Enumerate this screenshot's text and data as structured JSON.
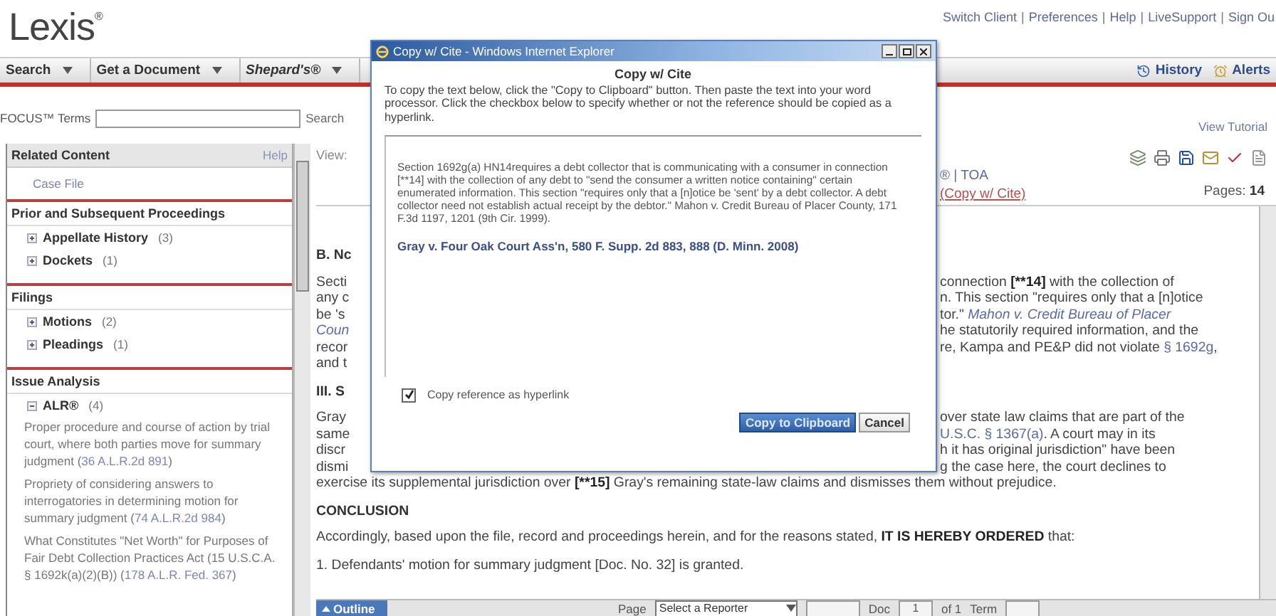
{
  "header": {
    "logo": "Lexis$^{®}$",
    "separator": "|",
    "links": [
      "Switch Client",
      "Preferences",
      "Help",
      "LiveSupport",
      "Sign Ou"
    ]
  },
  "nav": {
    "menus": [
      {
        "label": "Search",
        "italic": false
      },
      {
        "label": "Get a Document",
        "italic": false
      },
      {
        "label": "Shepard's®",
        "italic": true
      }
    ],
    "right": [
      {
        "label": "History",
        "kind": "history"
      },
      {
        "label": "Alerts",
        "kind": "clock"
      }
    ]
  },
  "focus": {
    "label": "FOCUS™ Terms",
    "button": "Search",
    "tutorial": "View Tutorial"
  },
  "sidebar": {
    "title": "Related Content",
    "help": "Help",
    "case_file": "Case File",
    "sections": [
      {
        "title": "Prior and Subsequent Proceedings",
        "items": [
          {
            "label": "Appellate History",
            "count": "(3)",
            "expanded": false
          },
          {
            "label": "Dockets",
            "count": "(1)",
            "expanded": false
          }
        ]
      },
      {
        "title": "Filings",
        "items": [
          {
            "label": "Motions",
            "count": "(2)",
            "expanded": false
          },
          {
            "label": "Pleadings",
            "count": "(1)",
            "expanded": false
          }
        ]
      },
      {
        "title": "Issue Analysis",
        "items": [
          {
            "label": "ALR®",
            "count": "(4)",
            "expanded": true,
            "children": [
              {
                "text": "Proper procedure and course of action by trial court, where both parties move for summary judgment (",
                "link": "36 A.L.R.2d 891",
                "after": ")"
              },
              {
                "text": "Propriety of considering answers to interrogatories in determining motion for summary judgment (",
                "link": "74 A.L.R.2d 984",
                "after": ")"
              },
              {
                "text": "What Constitutes \"Net Worth\" for Purposes of Fair Debt Collection Practices Act (15 U.S.C.A. § 1692k(a)(2)(B)) (",
                "link": "178 A.L.R. Fed. 367",
                "after": ")"
              }
            ]
          }
        ]
      }
    ]
  },
  "main": {
    "view_label": "View:",
    "toa": "® | TOA",
    "copy_cite": "(Copy w/ Cite)",
    "pages_label": "Pages:",
    "pages": "14",
    "tools": [
      {
        "kind": "stack"
      },
      {
        "kind": "print"
      },
      {
        "kind": "save"
      },
      {
        "kind": "mail"
      },
      {
        "kind": "check"
      },
      {
        "kind": "document"
      }
    ]
  },
  "body": [
    {
      "kind": "heading",
      "text": "B. Nc"
    },
    {
      "kind": "paragraph",
      "lines": [
        {
          "left": [
            {
              "text": "Secti"
            }
          ],
          "right": [
            {
              "text": "connection "
            },
            {
              "text": "[**14]",
              "kind": "bold"
            },
            {
              "text": " with the collection of"
            }
          ]
        },
        {
          "left": [
            {
              "text": "any c"
            }
          ],
          "right": [
            {
              "text": "n. This section \"requires only that a [n]otice"
            }
          ]
        },
        {
          "left": [
            {
              "text": "be 's"
            }
          ],
          "right": [
            {
              "text": "tor.\" "
            },
            {
              "text": "Mahon v. Credit Bureau of Placer",
              "kind": "italic_link"
            }
          ]
        },
        {
          "left": [
            {
              "text": "Coun",
              "kind": "italic_link"
            }
          ],
          "right": [
            {
              "text": "he statutorily required information, and the"
            }
          ]
        },
        {
          "left": [
            {
              "text": "recor"
            }
          ],
          "right": [
            {
              "text": "re, Kampa and PE&P did not violate "
            },
            {
              "text": "§ 1692g",
              "kind": "link"
            },
            {
              "text": ","
            }
          ]
        },
        {
          "left": [
            {
              "text": "and t"
            }
          ]
        }
      ]
    },
    {
      "kind": "heading",
      "text": "III. S"
    },
    {
      "kind": "paragraph",
      "lines": [
        {
          "left": [
            {
              "text": "Gray"
            }
          ],
          "right": [
            {
              "text": "over state law claims that are part of the"
            }
          ]
        },
        {
          "left": [
            {
              "text": "same"
            }
          ],
          "right": [
            {
              "text": "U.S.C. § 1367(a)",
              "kind": "link"
            },
            {
              "text": ". A court may in its"
            }
          ]
        },
        {
          "left": [
            {
              "text": "discr"
            }
          ],
          "right": [
            {
              "text": "h it has original jurisdiction\" have been"
            }
          ]
        },
        {
          "left": [
            {
              "text": "dismi"
            }
          ],
          "right": [
            {
              "text": "g the case here, the court declines to"
            }
          ]
        },
        {
          "full": [
            {
              "text": "exercise its supplemental jurisdiction over "
            },
            {
              "text": "[**15]",
              "kind": "bold"
            },
            {
              "text": " Gray's remaining state-law claims and dismisses them without prejudice."
            }
          ]
        }
      ]
    },
    {
      "kind": "heading",
      "text": "CONCLUSION"
    },
    {
      "kind": "paragraph",
      "lines": [
        {
          "full": [
            {
              "text": "Accordingly, based upon the file, record and proceedings herein, and for the reasons stated, "
            },
            {
              "text": "IT IS HEREBY ORDERED",
              "kind": "bold"
            },
            {
              "text": " that:"
            }
          ]
        }
      ]
    },
    {
      "kind": "paragraph",
      "lines": [
        {
          "full": [
            {
              "text": "1. Defendants' motion for summary judgment [Doc. No. 32] is granted."
            }
          ]
        }
      ]
    }
  ],
  "bottom_bar": {
    "outline": "Outline",
    "page_label": "Page",
    "reporter": "Select a Reporter",
    "doc_label": "Doc",
    "doc_value": "1",
    "doc_of": "of 1",
    "term_label": "Term"
  },
  "dialog": {
    "title": "Copy w/ Cite - Windows Internet Explorer",
    "heading": "Copy w/ Cite",
    "instructions": "To copy the text below, click the \"Copy to Clipboard\" button. Then paste the text into your word processor. Click the checkbox below to specify whether or not the reference should be copied as a hyperlink.",
    "excerpt": "Section 1692g(a) HN14requires a debt collector that is communicating with a consumer in connection [**14] with the collection of any debt to \"send the consumer a written notice containing\" certain enumerated information. This section \"requires only that a [n]otice be 'sent' by a debt collector. A debt collector need not establish actual receipt by the debtor.\" Mahon v. Credit Bureau of Placer County, 171 F.3d 1197, 1201 (9th Cir. 1999).",
    "citation": "Gray v. Four Oak Court Ass'n, 580 F. Supp. 2d 883, 888 (D. Minn. 2008)",
    "hyperlink": {
      "label": "Copy reference as hyperlink",
      "checked": true
    },
    "buttons": [
      {
        "label": "Copy to Clipboard",
        "primary": true
      },
      {
        "label": "Cancel",
        "primary": false
      }
    ]
  }
}
